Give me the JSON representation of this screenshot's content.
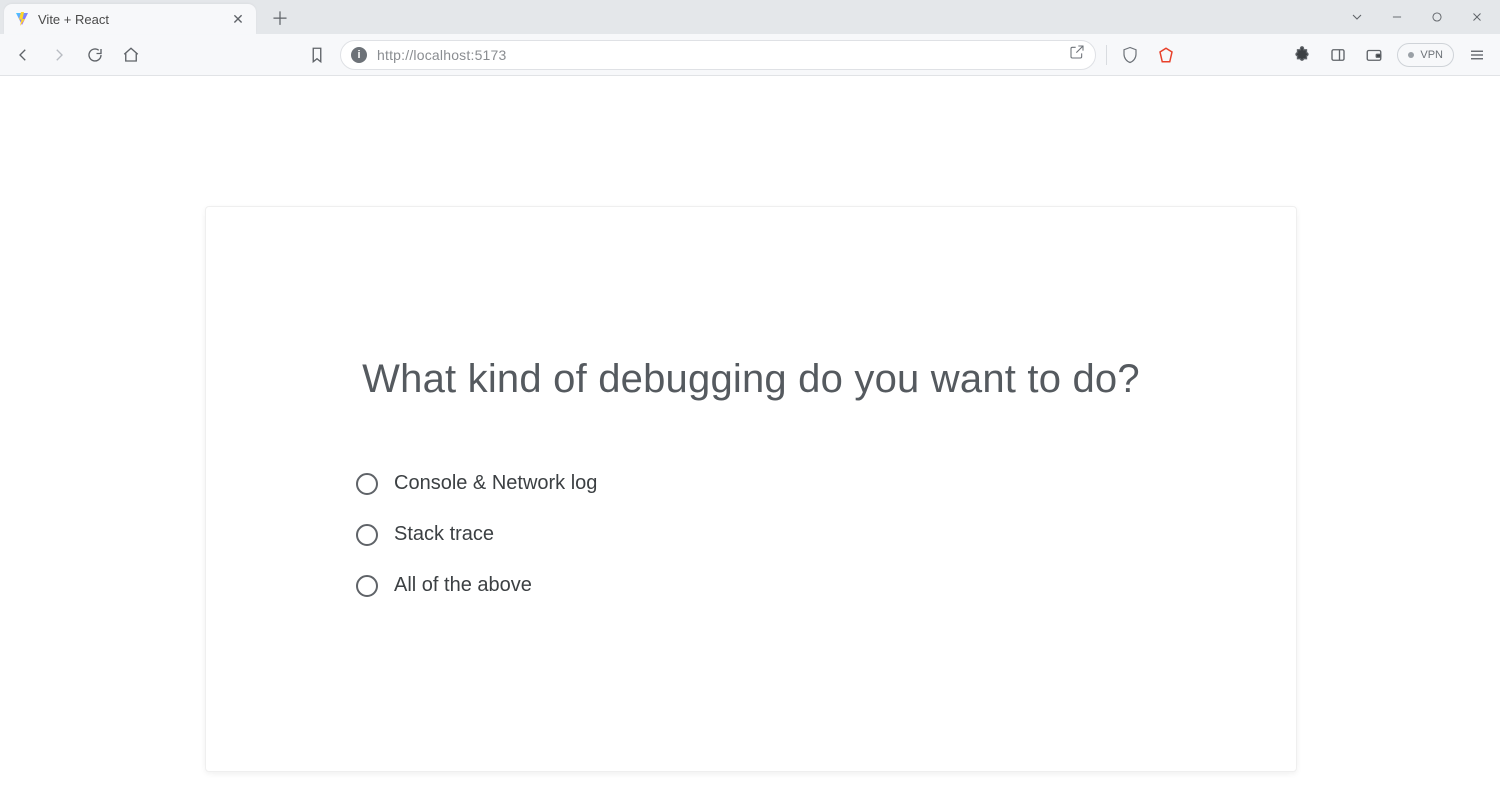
{
  "browser": {
    "tab_title": "Vite + React",
    "url": "http://localhost:5173",
    "vpn_label": "VPN"
  },
  "page": {
    "question": "What kind of debugging do you want to do?",
    "options": [
      {
        "label": "Console & Network log"
      },
      {
        "label": "Stack trace"
      },
      {
        "label": "All of the above"
      }
    ]
  }
}
